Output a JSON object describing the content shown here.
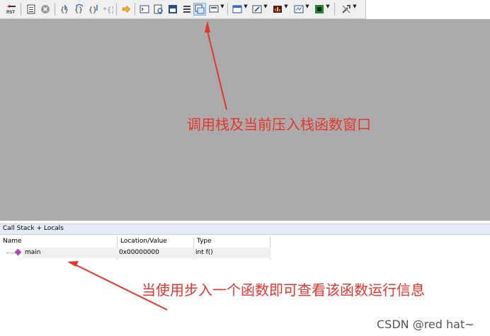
{
  "toolbar": {
    "icons": [
      "rst-icon",
      "disasm-icon",
      "stop-icon",
      "step-in-icon",
      "step-over-icon",
      "step-out-icon",
      "run-to-cursor-icon",
      "show-next-statement-icon",
      "command-window-icon",
      "disassembly-window-icon",
      "symbols-window-icon",
      "registers-window-icon",
      "call-stack-window-icon",
      "watch-window-icon",
      "memory-window-icon",
      "serial-window-icon",
      "analysis-window-icon",
      "trace-window-icon",
      "system-viewer-icon",
      "toolbox-icon"
    ],
    "labels": {
      "rst": "RST"
    },
    "active_icon": "call-stack-window-icon"
  },
  "annotations": {
    "top": "调用栈及当前压入栈函数窗口",
    "bottom": "当使用步入一个函数即可查看该函数运行信息"
  },
  "panel": {
    "title": "Call Stack + Locals",
    "columns": [
      "Name",
      "Location/Value",
      "Type"
    ],
    "rows": [
      {
        "name": "main",
        "location": "0x00000000",
        "type": "int f()"
      }
    ]
  },
  "watermark": "CSDN @red hat~",
  "colors": {
    "workspace": "#ababab",
    "annotation": "#e8342f",
    "panel_title_bg": "#e4ecf5",
    "toolbar_bg": "#f0f0f0"
  }
}
